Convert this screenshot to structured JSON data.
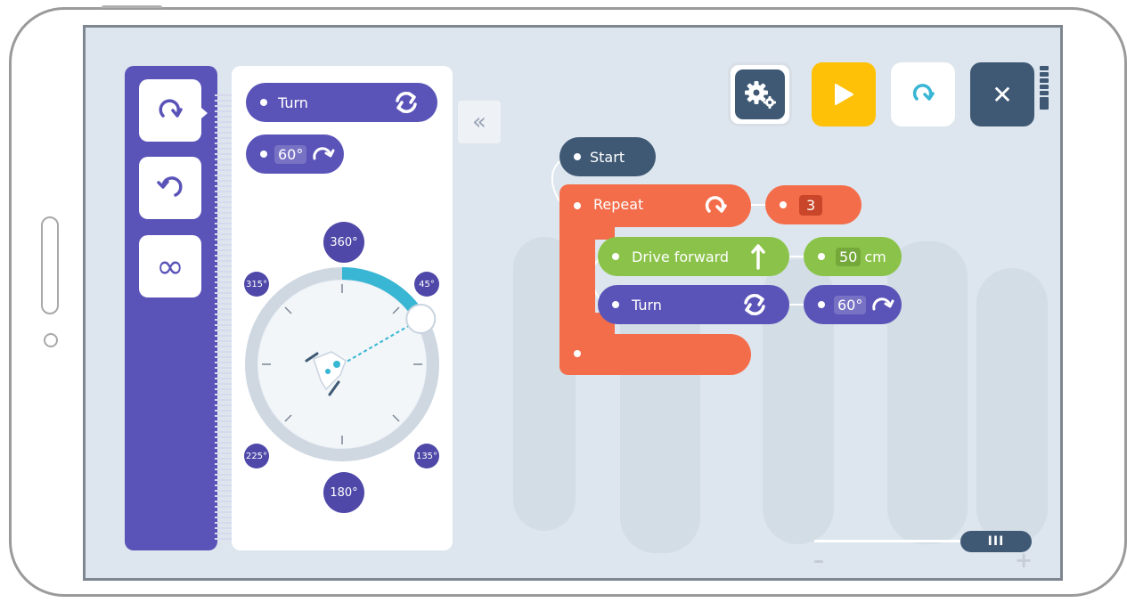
{
  "palette": {
    "turn_block": {
      "label": "Turn",
      "icon": "rotate-both-icon"
    },
    "angle_block": {
      "value": "60°",
      "icon": "turn-right-arrow-icon"
    }
  },
  "categories": [
    {
      "name": "rotate-clockwise",
      "icon": "rotate-clockwise-icon"
    },
    {
      "name": "rotate-counterclockwise",
      "icon": "rotate-counterclockwise-icon"
    },
    {
      "name": "infinite-loop",
      "icon": "infinity-icon",
      "glyph": "∞"
    }
  ],
  "dial": {
    "labels": {
      "d360": "360°",
      "d45": "45°",
      "d135": "135°",
      "d180": "180°",
      "d225": "225°",
      "d315": "315°"
    },
    "selected_angle_deg": 60
  },
  "collapse_glyph": "«",
  "toolbar": {
    "settings": "settings-gears-icon",
    "play": "play-icon",
    "reset": "reset-icon",
    "close": "close-icon",
    "close_glyph": "✕"
  },
  "program": {
    "start_label": "Start",
    "repeat_label": "Repeat",
    "repeat_count": "3",
    "drive_label": "Drive forward",
    "drive_distance": "50",
    "drive_unit": "cm",
    "turn_label": "Turn",
    "turn_angle": "60°"
  },
  "zoom": {
    "handle_glyph": "III",
    "minus": "–",
    "plus": "+"
  },
  "colors": {
    "purple": "#5b54b8",
    "orange": "#f36d4a",
    "green": "#8bc34a",
    "navy": "#3f5975",
    "yellow": "#ffc107",
    "teal": "#38b6d4"
  }
}
